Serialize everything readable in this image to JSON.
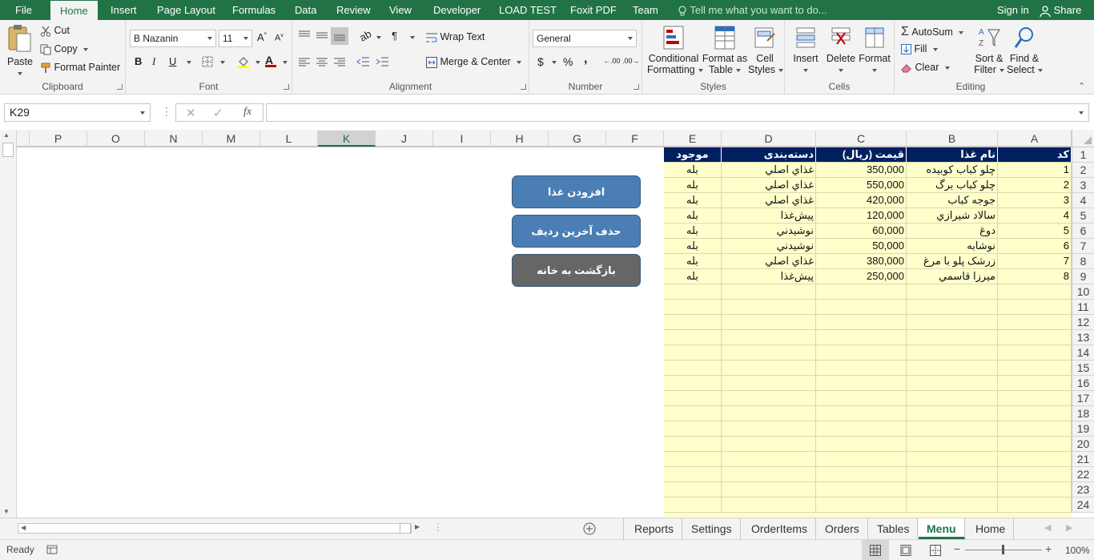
{
  "ribbon_tabs": [
    "File",
    "Home",
    "Insert",
    "Page Layout",
    "Formulas",
    "Data",
    "Review",
    "View",
    "Developer",
    "LOAD TEST",
    "Foxit PDF",
    "Team"
  ],
  "tell_me": "Tell me what you want to do...",
  "account": {
    "sign_in": "Sign in",
    "share": "Share"
  },
  "clipboard": {
    "paste": "Paste",
    "cut": "Cut",
    "copy": "Copy",
    "format_painter": "Format Painter",
    "label": "Clipboard"
  },
  "font": {
    "name": "B Nazanin",
    "size": "11",
    "bold": "B",
    "italic": "I",
    "underline": "U",
    "label": "Font"
  },
  "alignment": {
    "wrap_text": "Wrap Text",
    "merge_center": "Merge & Center",
    "label": "Alignment"
  },
  "number": {
    "format": "General",
    "currency": "$",
    "percent": "%",
    "comma": ",",
    "label": "Number"
  },
  "styles": {
    "conditional": "Conditional",
    "formatting": "Formatting",
    "format_as": "Format as",
    "table": "Table",
    "cell": "Cell",
    "cell_styles": "Styles",
    "label": "Styles"
  },
  "cells": {
    "insert": "Insert",
    "delete": "Delete",
    "format": "Format",
    "label": "Cells"
  },
  "editing": {
    "autosum": "AutoSum",
    "fill": "Fill",
    "clear": "Clear",
    "sort": "Sort &",
    "filter": "Filter",
    "find": "Find &",
    "select": "Select",
    "label": "Editing"
  },
  "formula_bar": {
    "name_box": "K29",
    "fx": "fx",
    "content": ""
  },
  "columns": [
    "P",
    "O",
    "N",
    "M",
    "L",
    "K",
    "J",
    "I",
    "H",
    "G",
    "F",
    "E",
    "D",
    "C",
    "B",
    "A"
  ],
  "selected_column": "K",
  "rows": [
    "1",
    "2",
    "3",
    "4",
    "5",
    "6",
    "7",
    "8",
    "9",
    "10",
    "11",
    "12",
    "13",
    "14",
    "15",
    "16",
    "17",
    "18",
    "19",
    "20",
    "21",
    "22",
    "23",
    "24"
  ],
  "table": {
    "headers": [
      "کد",
      "نام غذا",
      "قیمت (ریال)",
      "دسته‌بندی",
      "موجود"
    ],
    "data": [
      [
        "1",
        "چلو کباب کوبیده",
        "350,000",
        "غذاي اصلي",
        "بله"
      ],
      [
        "2",
        "چلو کباب برگ",
        "550,000",
        "غذاي اصلي",
        "بله"
      ],
      [
        "3",
        "جوجه کباب",
        "420,000",
        "غذاي اصلي",
        "بله"
      ],
      [
        "4",
        "سالاد شيرازي",
        "120,000",
        "پيش‌غذا",
        "بله"
      ],
      [
        "5",
        "دوغ",
        "60,000",
        "نوشيدني",
        "بله"
      ],
      [
        "6",
        "نوشابه",
        "50,000",
        "نوشيدني",
        "بله"
      ],
      [
        "7",
        "زرشک پلو با مرغ",
        "380,000",
        "غذاي اصلي",
        "بله"
      ],
      [
        "8",
        "ميرزا قاسمي",
        "250,000",
        "پيش‌غذا",
        "بله"
      ]
    ]
  },
  "shapes": [
    {
      "label": "افزودن غذا",
      "color": "#4a7eb5"
    },
    {
      "label": "حذف آخرین ردیف",
      "color": "#4a7eb5"
    },
    {
      "label": "بازگشت به خانه",
      "color": "#666666"
    }
  ],
  "sheet_tabs": [
    "Reports",
    "Settings",
    "OrderItems",
    "Orders",
    "Tables",
    "Menu",
    "Home"
  ],
  "active_sheet": "Menu",
  "status": {
    "ready": "Ready",
    "zoom": "100%"
  },
  "colors": {
    "accent": "#217346",
    "header_fill": "#002060",
    "table_fill": "#ffffcc"
  }
}
